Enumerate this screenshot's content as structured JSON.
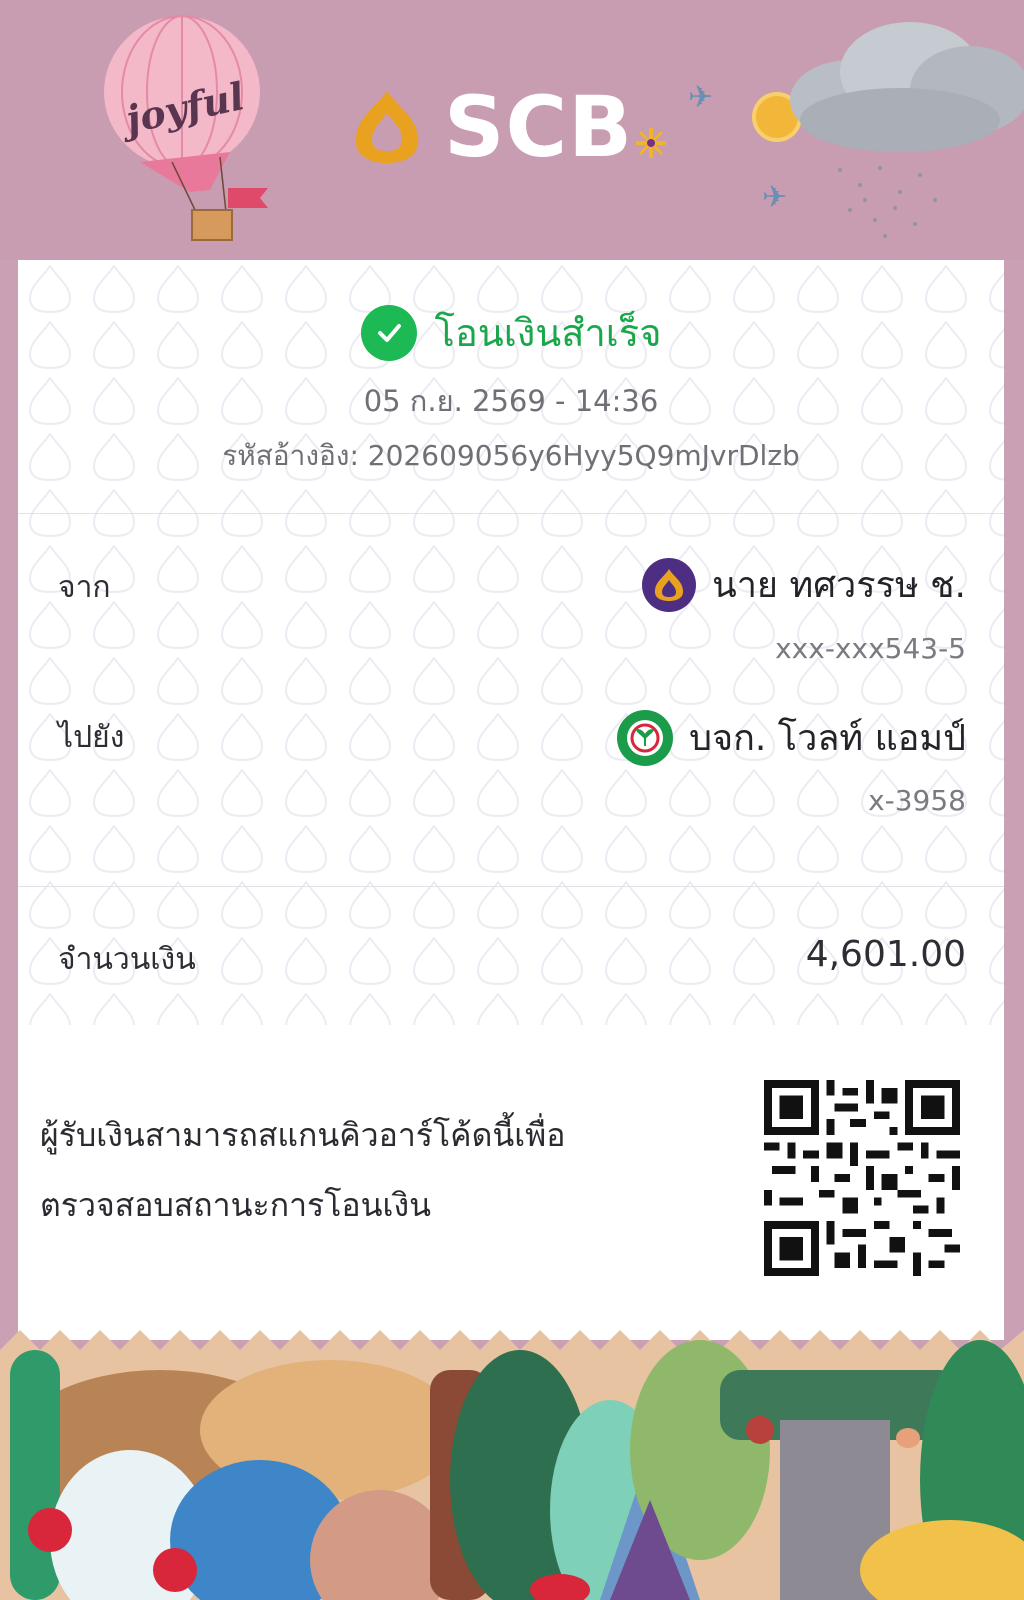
{
  "header": {
    "brand": "SCB",
    "balloon_text": "joyful"
  },
  "status": {
    "title": "โอนเงินสำเร็จ",
    "datetime": "05 ก.ย. 2569 - 14:36",
    "reference": "รหัสอ้างอิง: 202609056y6Hyy5Q9mJvrDlzb"
  },
  "sender": {
    "label": "จาก",
    "name": "นาย ทศวรรษ ช.",
    "account": "xxx-xxx543-5",
    "bank_icon": "scb-bank-icon"
  },
  "receiver": {
    "label": "ไปยัง",
    "name": "บจก. โวลท์ แอมป์",
    "account": "x-3958",
    "bank_icon": "kbank-bank-icon"
  },
  "amount": {
    "label": "จำนวนเงิน",
    "value": "4,601.00"
  },
  "qr_note": {
    "line1": "ผู้รับเงินสามารถสแกนคิวอาร์โค้ดนี้เพื่อ",
    "line2": "ตรวจสอบสถานะการโอนเงิน"
  },
  "colors": {
    "header_bg": "#c89cb1",
    "success_green": "#1db954",
    "scb_purple": "#4e2e82",
    "kbank_green": "#1b9c4a"
  }
}
